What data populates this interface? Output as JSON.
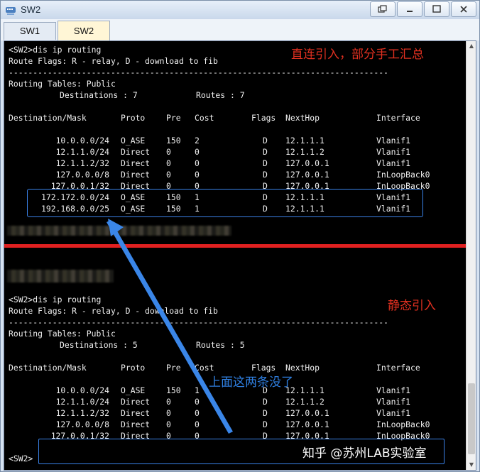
{
  "window": {
    "title": "SW2",
    "buttons": [
      "restore-icon",
      "minimize-icon",
      "maximize-icon",
      "close-icon"
    ]
  },
  "tabs": [
    {
      "label": "SW1",
      "active": false
    },
    {
      "label": "SW2",
      "active": true
    }
  ],
  "colors": {
    "terminal_bg": "#000000",
    "terminal_text": "#f0f0f0",
    "annotation_red": "#e03020",
    "annotation_blue": "#2f7fe0",
    "highlight_box": "#3a82e8",
    "divider": "#e02020",
    "active_tab": "#fff6d6"
  },
  "annotations": {
    "top": "直连引入，部分手工汇总",
    "bottom": "静态引入",
    "arrow_note": "上面这两条没了"
  },
  "watermark": "知乎 @苏州LAB实验室",
  "section1": {
    "prompt": "<SW2>dis ip routing",
    "flags": "Route Flags: R - relay, D - download to fib",
    "separator": "------------------------------------------------------------------------------",
    "tables": "Routing Tables: Public",
    "dest_label": "Destinations : 7",
    "routes_label": "Routes : 7",
    "headers": [
      "Destination/Mask",
      "Proto",
      "Pre",
      "Cost",
      "Flags",
      "NextHop",
      "Interface"
    ],
    "rows": [
      [
        "10.0.0.0/24",
        "O_ASE",
        "150",
        "2",
        "D",
        "12.1.1.1",
        "Vlanif1"
      ],
      [
        "12.1.1.0/24",
        "Direct",
        "0",
        "0",
        "D",
        "12.1.1.2",
        "Vlanif1"
      ],
      [
        "12.1.1.2/32",
        "Direct",
        "0",
        "0",
        "D",
        "127.0.0.1",
        "Vlanif1"
      ],
      [
        "127.0.0.0/8",
        "Direct",
        "0",
        "0",
        "D",
        "127.0.0.1",
        "InLoopBack0"
      ],
      [
        "127.0.0.1/32",
        "Direct",
        "0",
        "0",
        "D",
        "127.0.0.1",
        "InLoopBack0"
      ],
      [
        "172.172.0.0/24",
        "O_ASE",
        "150",
        "1",
        "D",
        "12.1.1.1",
        "Vlanif1"
      ],
      [
        "192.168.0.0/25",
        "O_ASE",
        "150",
        "1",
        "D",
        "12.1.1.1",
        "Vlanif1"
      ]
    ]
  },
  "section2": {
    "prompt": "<SW2>dis ip routing",
    "flags": "Route Flags: R - relay, D - download to fib",
    "separator": "------------------------------------------------------------------------------",
    "tables": "Routing Tables: Public",
    "dest_label": "Destinations : 5",
    "routes_label": "Routes : 5",
    "headers": [
      "Destination/Mask",
      "Proto",
      "Pre",
      "Cost",
      "Flags",
      "NextHop",
      "Interface"
    ],
    "rows": [
      [
        "10.0.0.0/24",
        "O_ASE",
        "150",
        "1",
        "D",
        "12.1.1.1",
        "Vlanif1"
      ],
      [
        "12.1.1.0/24",
        "Direct",
        "0",
        "0",
        "D",
        "12.1.1.2",
        "Vlanif1"
      ],
      [
        "12.1.1.2/32",
        "Direct",
        "0",
        "0",
        "D",
        "127.0.0.1",
        "Vlanif1"
      ],
      [
        "127.0.0.0/8",
        "Direct",
        "0",
        "0",
        "D",
        "127.0.0.1",
        "InLoopBack0"
      ],
      [
        "127.0.0.1/32",
        "Direct",
        "0",
        "0",
        "D",
        "127.0.0.1",
        "InLoopBack0"
      ]
    ]
  },
  "current_prompt": "<SW2>"
}
